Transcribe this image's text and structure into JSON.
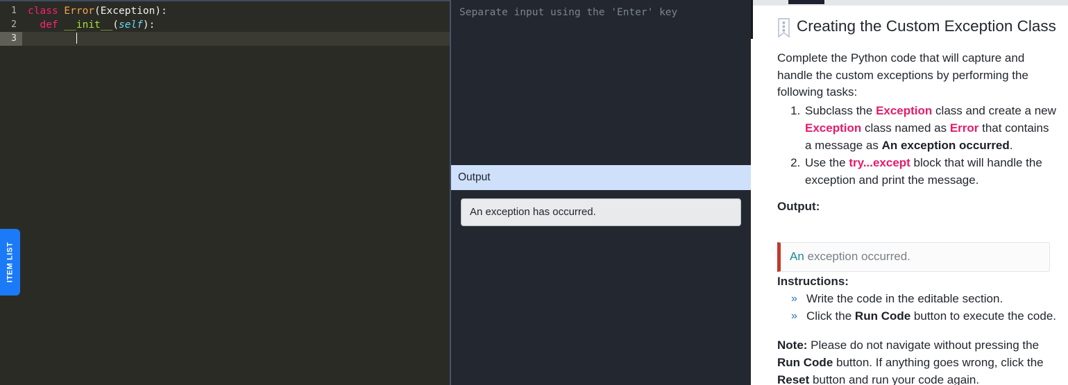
{
  "editor": {
    "lines": [
      {
        "num": "1",
        "active": false,
        "tokens": [
          {
            "t": "class",
            "c": "kw"
          },
          {
            "t": " ",
            "c": "plain"
          },
          {
            "t": "Error",
            "c": "class"
          },
          {
            "t": "(Exception):",
            "c": "plain"
          }
        ]
      },
      {
        "num": "2",
        "active": false,
        "tokens": [
          {
            "t": "  ",
            "c": "plain"
          },
          {
            "t": "def",
            "c": "kw2"
          },
          {
            "t": " ",
            "c": "plain"
          },
          {
            "t": "__init__",
            "c": "fn"
          },
          {
            "t": "(",
            "c": "plain"
          },
          {
            "t": "self",
            "c": "param"
          },
          {
            "t": "):",
            "c": "plain"
          }
        ]
      },
      {
        "num": "3",
        "active": true,
        "tokens": [
          {
            "t": "        ",
            "c": "plain"
          }
        ]
      }
    ],
    "item_list_tab_label": "ITEM LIST"
  },
  "io": {
    "input_placeholder": "Separate input using the 'Enter' key",
    "input_value": "",
    "output_header": "Output",
    "output_text": "An exception has occurred."
  },
  "instructions": {
    "bookmark_icon": "bookmark-icon",
    "title": "Creating the Custom Exception Class",
    "intro": "Complete the Python code that will capture and handle the custom exceptions by performing the following tasks:",
    "tasks": [
      {
        "parts": [
          {
            "t": "Subclass the ",
            "s": "normal"
          },
          {
            "t": "Exception",
            "s": "pink"
          },
          {
            "t": " class and create a new ",
            "s": "normal"
          },
          {
            "t": "Exception",
            "s": "pink"
          },
          {
            "t": " class named as ",
            "s": "normal"
          },
          {
            "t": "Error",
            "s": "pink"
          },
          {
            "t": " that contains a message as ",
            "s": "normal"
          },
          {
            "t": "An exception occurred",
            "s": "strong"
          },
          {
            "t": ".",
            "s": "normal"
          }
        ]
      },
      {
        "parts": [
          {
            "t": "Use the ",
            "s": "normal"
          },
          {
            "t": "try...except",
            "s": "pink"
          },
          {
            "t": " block that will handle the exception and print the message.",
            "s": "normal"
          }
        ]
      }
    ],
    "output_label": "Output:",
    "expected_output_first_word": "An",
    "expected_output_rest": " exception occurred.",
    "instructions_label": "Instructions:",
    "instruction_items": [
      {
        "bullet": "»",
        "parts": [
          {
            "t": "Write the code in the editable section.",
            "s": "normal"
          }
        ]
      },
      {
        "bullet": "»",
        "parts": [
          {
            "t": "Click the ",
            "s": "normal"
          },
          {
            "t": "Run Code",
            "s": "strong"
          },
          {
            "t": " button to execute the code.",
            "s": "normal"
          }
        ]
      }
    ],
    "note": {
      "parts": [
        {
          "t": "Note:",
          "s": "strong"
        },
        {
          "t": " Please do not navigate without pressing the ",
          "s": "normal"
        },
        {
          "t": "Run Code",
          "s": "strong"
        },
        {
          "t": " button. If anything goes wrong, click the ",
          "s": "normal"
        },
        {
          "t": "Reset",
          "s": "strong"
        },
        {
          "t": " button and run your code again.",
          "s": "normal"
        }
      ]
    }
  },
  "colors": {
    "accent_blue": "#1a7af8",
    "pink": "#e61a6b",
    "output_header_bg": "#cfe0fb",
    "editor_bg": "#2b2b26",
    "io_bg": "#232830",
    "callout_border": "#c0392b",
    "teal": "#1a8a96"
  }
}
